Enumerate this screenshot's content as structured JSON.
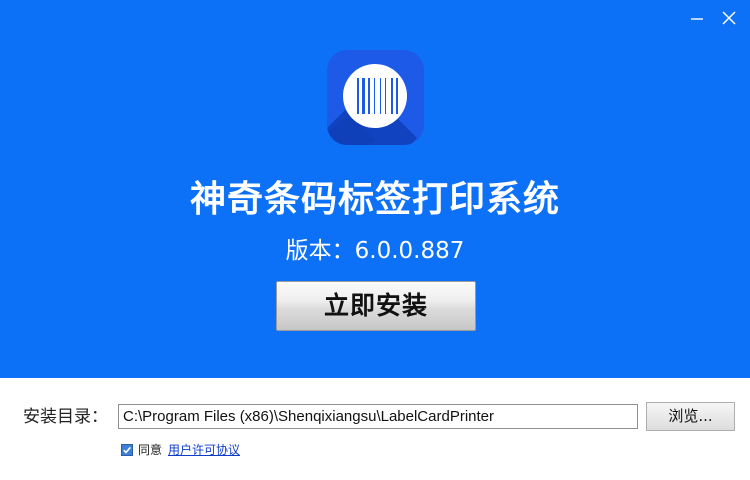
{
  "window": {
    "minimize_icon": "minimize-icon",
    "close_icon": "close-icon"
  },
  "hero": {
    "background_color": "#0d71f7",
    "app_icon": "barcode-icon",
    "title": "神奇条码标签打印系统",
    "version_label": "版本：",
    "version_value": "6.0.0.887",
    "install_button_label": "立即安装"
  },
  "install_dir": {
    "label": "安装目录：",
    "path_value": "C:\\Program Files (x86)\\Shenqixiangsu\\LabelCardPrinter",
    "browse_button_label": "浏览..."
  },
  "agreement": {
    "checked": true,
    "label": "同意",
    "link_text": "用户许可协议"
  }
}
